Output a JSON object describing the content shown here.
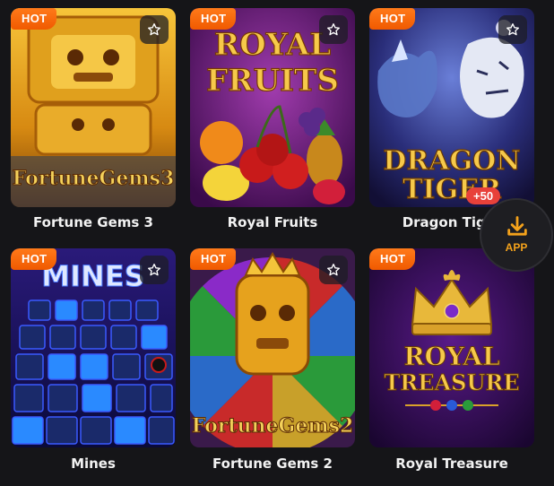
{
  "colors": {
    "background": "#151518",
    "hot_badge": "#f05a00",
    "accent": "#f4a21b",
    "bonus_badge": "#e8413a"
  },
  "games": [
    {
      "title": "Fortune Gems 3",
      "badge": "HOT",
      "art_text": "FortuneGems3"
    },
    {
      "title": "Royal Fruits",
      "badge": "HOT",
      "art_text_1": "ROYAL",
      "art_text_2": "FRUITS"
    },
    {
      "title": "Dragon Tiger",
      "badge": "HOT",
      "art_text_1": "DRAGON",
      "art_text_2": "TIGER"
    },
    {
      "title": "Mines",
      "badge": "HOT",
      "art_text": "MINES"
    },
    {
      "title": "Fortune Gems 2",
      "badge": "HOT",
      "art_text": "FortuneGems2"
    },
    {
      "title": "Royal Treasure",
      "badge": "HOT",
      "art_text_1": "ROYAL",
      "art_text_2": "TREASURE"
    }
  ],
  "app_button": {
    "label": "APP",
    "bonus": "+50",
    "icon": "download-icon"
  },
  "icons": {
    "favorite": "star-icon"
  }
}
